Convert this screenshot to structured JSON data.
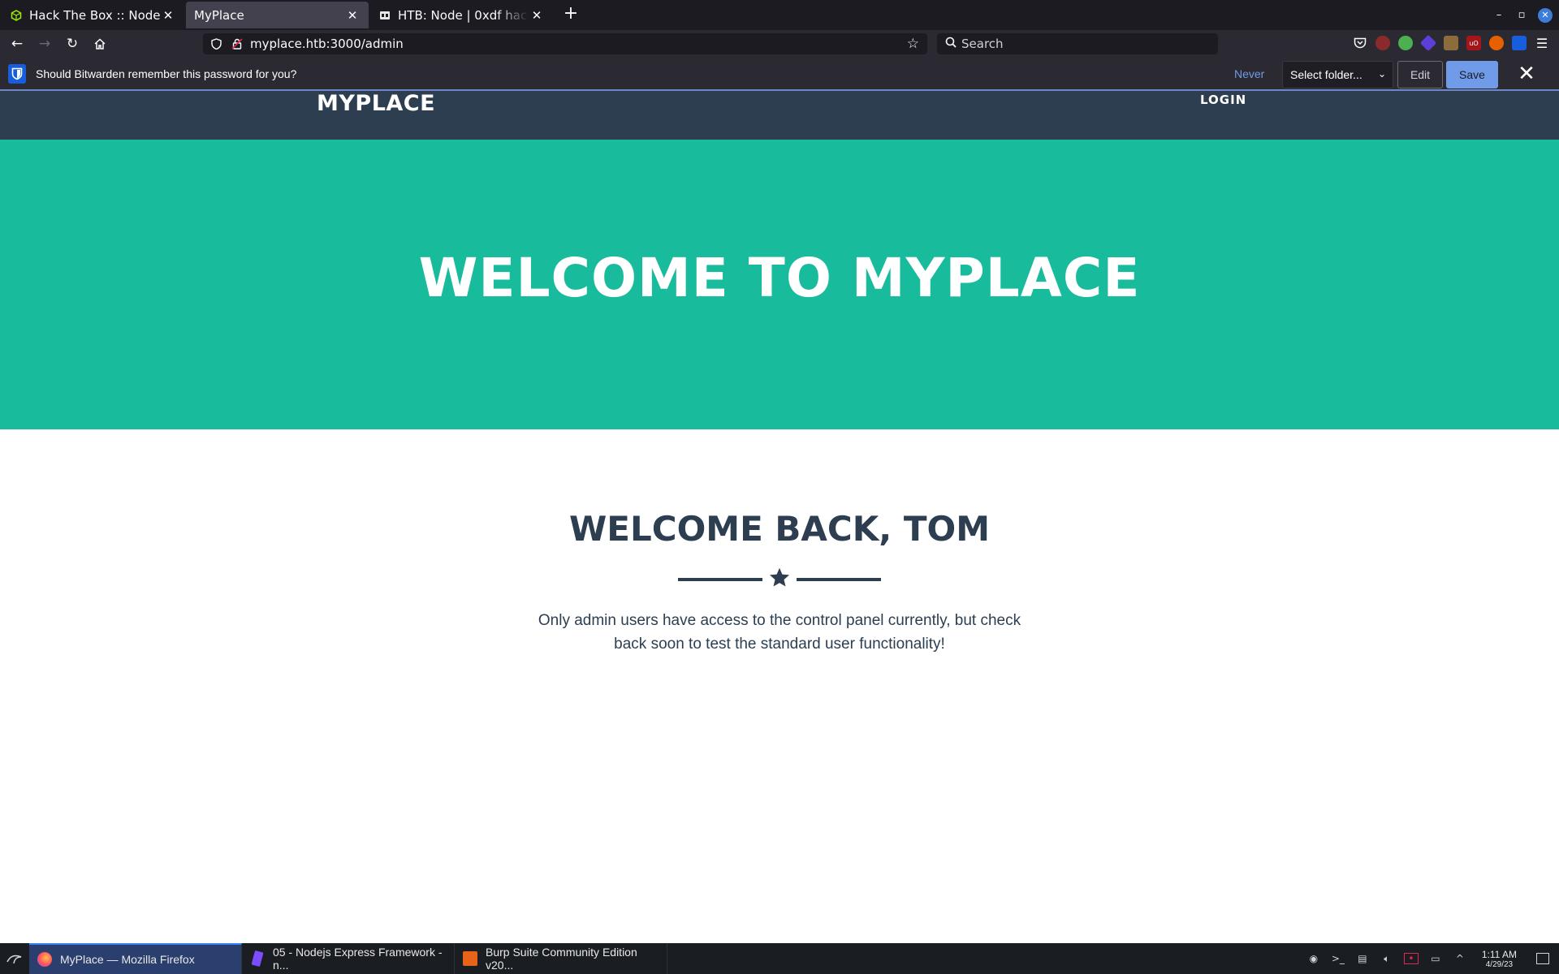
{
  "browser": {
    "tabs": [
      {
        "title": "Hack The Box :: Node",
        "icon": "htb-cube-icon"
      },
      {
        "title": "MyPlace",
        "icon": "none"
      },
      {
        "title": "HTB: Node | 0xdf hacks stuff",
        "icon": "0xdf-icon"
      }
    ],
    "new_tab_label": "+",
    "url": "myplace.htb:3000/admin",
    "search_placeholder": "Search"
  },
  "bitwarden": {
    "prompt": "Should Bitwarden remember this password for you?",
    "never_label": "Never",
    "folder_select": "Select folder...",
    "edit_label": "Edit",
    "save_label": "Save",
    "accent_color": "#6f9be8"
  },
  "site": {
    "brand": "MYPLACE",
    "login_label": "LOGIN",
    "hero_title": "WELCOME TO MYPLACE",
    "welcome_heading": "WELCOME BACK, TOM",
    "description": "Only admin users have access to the control panel currently, but check back soon to test the standard user functionality!",
    "colors": {
      "nav": "#2c3e50",
      "hero": "#18bc9c",
      "text": "#2c3e50"
    }
  },
  "taskbar": {
    "items": [
      {
        "label": "MyPlace — Mozilla Firefox",
        "icon": "firefox-icon"
      },
      {
        "label": "05 - Nodejs Express Framework - n...",
        "icon": "obsidian-icon"
      },
      {
        "label": "Burp Suite Community Edition v20...",
        "icon": "burp-icon"
      }
    ],
    "time": "1:11 AM",
    "date": "4/29/23"
  }
}
